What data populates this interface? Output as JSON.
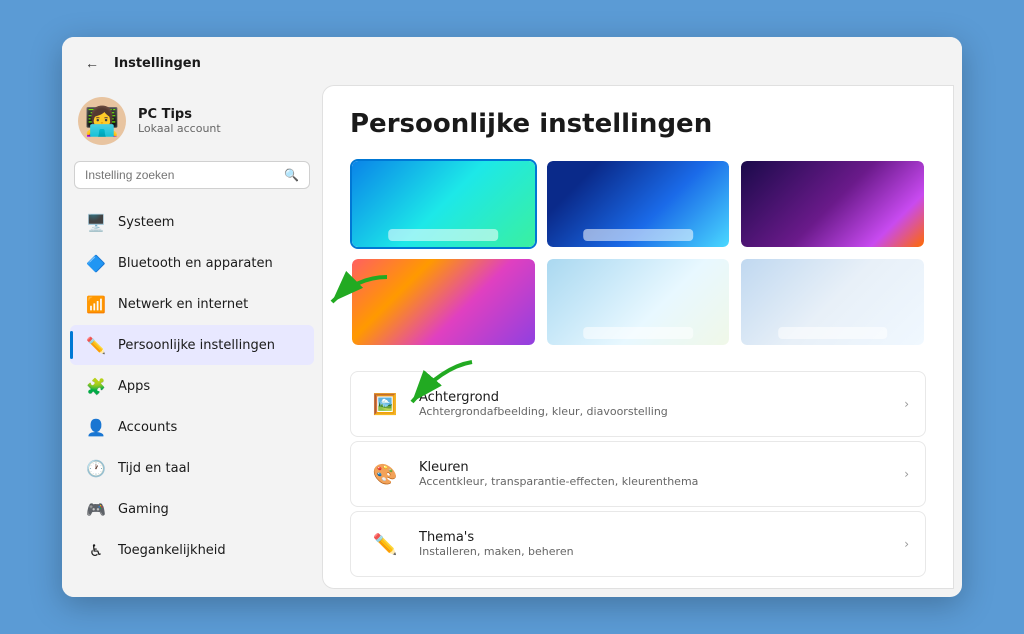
{
  "titleBar": {
    "title": "Instellingen",
    "backLabel": "←"
  },
  "user": {
    "name": "PC Tips",
    "accountType": "Lokaal account",
    "avatarEmoji": "👩‍💻"
  },
  "search": {
    "placeholder": "Instelling zoeken"
  },
  "navItems": [
    {
      "id": "systeem",
      "label": "Systeem",
      "icon": "🖥️"
    },
    {
      "id": "bluetooth",
      "label": "Bluetooth en apparaten",
      "icon": "🔷"
    },
    {
      "id": "netwerk",
      "label": "Netwerk en internet",
      "icon": "📶"
    },
    {
      "id": "persoonlijk",
      "label": "Persoonlijke instellingen",
      "icon": "✏️",
      "active": true
    },
    {
      "id": "apps",
      "label": "Apps",
      "icon": "🧩"
    },
    {
      "id": "accounts",
      "label": "Accounts",
      "icon": "👤"
    },
    {
      "id": "tijd",
      "label": "Tijd en taal",
      "icon": "🕐"
    },
    {
      "id": "gaming",
      "label": "Gaming",
      "icon": "🎮"
    },
    {
      "id": "toegankelijkheid",
      "label": "Toegankelijkheid",
      "icon": "♿"
    }
  ],
  "pageTitle": "Persoonlijke instellingen",
  "settingsItems": [
    {
      "id": "achtergrond",
      "title": "Achtergrond",
      "desc": "Achtergrondafbeelding, kleur, diavoorstelling",
      "icon": "🖼️"
    },
    {
      "id": "kleuren",
      "title": "Kleuren",
      "desc": "Accentkleur, transparantie-effecten, kleurenthema",
      "icon": "🎨"
    },
    {
      "id": "themas",
      "title": "Thema's",
      "desc": "Installeren, maken, beheren",
      "icon": "✏️"
    }
  ],
  "colors": {
    "accent": "#0078d4",
    "activeNav": "#e8e8ff",
    "activeNavBorder": "#0078d4"
  }
}
